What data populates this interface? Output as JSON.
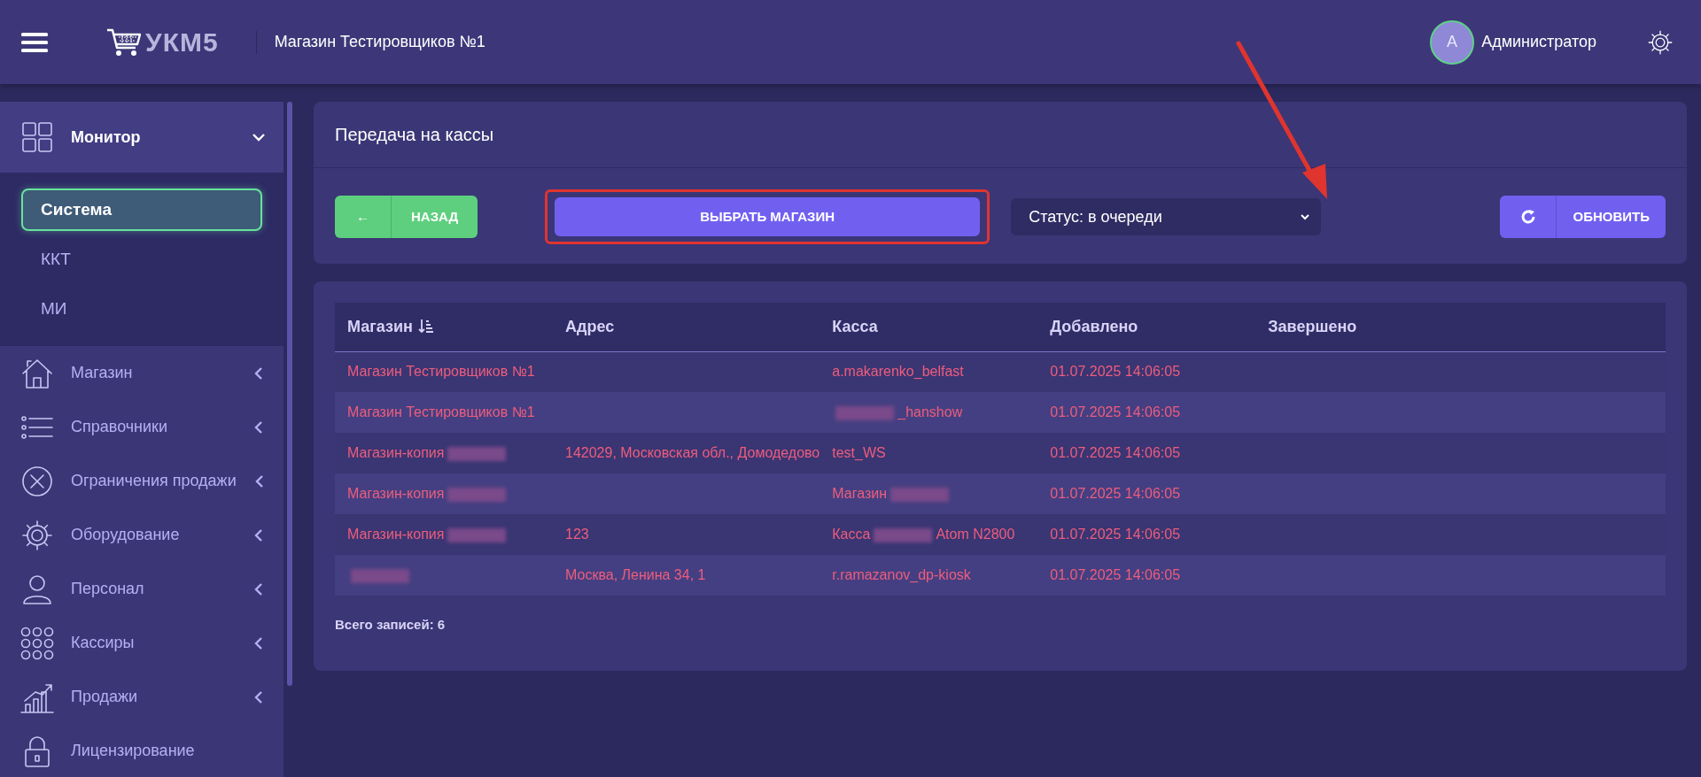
{
  "header": {
    "logo_text": "УКМ5",
    "store_title": "Магазин Тестировщиков №1",
    "user": {
      "avatar_letter": "А",
      "name": "Администратор"
    }
  },
  "sidebar": {
    "items": [
      {
        "label": "Монитор",
        "kind": "grid",
        "expanded": true,
        "children": [
          {
            "label": "Система",
            "selected": true
          },
          {
            "label": "ККТ",
            "selected": false
          },
          {
            "label": "МИ",
            "selected": false
          }
        ]
      },
      {
        "label": "Магазин",
        "kind": "house",
        "expanded": false
      },
      {
        "label": "Справочники",
        "kind": "list",
        "expanded": false
      },
      {
        "label": "Ограничения продажи",
        "kind": "xcircle",
        "expanded": false
      },
      {
        "label": "Оборудование",
        "kind": "gear",
        "expanded": false
      },
      {
        "label": "Персонал",
        "kind": "person",
        "expanded": false
      },
      {
        "label": "Кассиры",
        "kind": "dots",
        "expanded": false
      },
      {
        "label": "Продажи",
        "kind": "chart",
        "expanded": false
      },
      {
        "label": "Лицензирование",
        "kind": "lock"
      }
    ]
  },
  "panel": {
    "title": "Передача на кассы",
    "back_button": {
      "icon": "←",
      "label": "НАЗАД"
    },
    "select_store_button": {
      "label": "ВЫБРАТЬ МАГАЗИН",
      "highlighted": true
    },
    "status_select": {
      "value": "Статус: в очереди"
    },
    "refresh_button": {
      "label": "ОБНОВИТЬ"
    }
  },
  "annotation_arrow": true,
  "table": {
    "columns": [
      "Магазин",
      "Адрес",
      "Касса",
      "Добавлено",
      "Завершено"
    ],
    "rows": [
      [
        [
          {
            "kind": "text",
            "text": "Магазин Тестировщиков №1"
          }
        ],
        [],
        [
          {
            "kind": "text",
            "text": "a.makarenko_belfast"
          }
        ],
        [
          {
            "kind": "text",
            "text": "01.07.2025 14:06:05"
          }
        ],
        []
      ],
      [
        [
          {
            "kind": "text",
            "text": "Магазин Тестировщиков №1"
          }
        ],
        [],
        [
          {
            "kind": "redacted"
          },
          {
            "kind": "text",
            "text": "_hanshow"
          }
        ],
        [
          {
            "kind": "text",
            "text": "01.07.2025 14:06:05"
          }
        ],
        []
      ],
      [
        [
          {
            "kind": "text",
            "text": "Магазин-копия"
          },
          {
            "kind": "redacted"
          }
        ],
        [
          {
            "kind": "text",
            "text": "142029, Московская обл., Домодедово"
          }
        ],
        [
          {
            "kind": "text",
            "text": "test_WS"
          }
        ],
        [
          {
            "kind": "text",
            "text": "01.07.2025 14:06:05"
          }
        ],
        []
      ],
      [
        [
          {
            "kind": "text",
            "text": "Магазин-копия"
          },
          {
            "kind": "redacted"
          }
        ],
        [],
        [
          {
            "kind": "text",
            "text": "Магазин"
          },
          {
            "kind": "redacted"
          }
        ],
        [
          {
            "kind": "text",
            "text": "01.07.2025 14:06:05"
          }
        ],
        []
      ],
      [
        [
          {
            "kind": "text",
            "text": "Магазин-копия"
          },
          {
            "kind": "redacted"
          }
        ],
        [
          {
            "kind": "text",
            "text": "123"
          }
        ],
        [
          {
            "kind": "text",
            "text": "Касса"
          },
          {
            "kind": "redacted"
          },
          {
            "kind": "text",
            "text": "Atom N2800"
          }
        ],
        [
          {
            "kind": "text",
            "text": "01.07.2025 14:06:05"
          }
        ],
        []
      ],
      [
        [
          {
            "kind": "redacted"
          }
        ],
        [
          {
            "kind": "text",
            "text": "Москва, Ленина 34, 1"
          }
        ],
        [
          {
            "kind": "text",
            "text": "r.ramazanov_dp-kiosk"
          }
        ],
        [
          {
            "kind": "text",
            "text": "01.07.2025 14:06:05"
          }
        ],
        []
      ]
    ],
    "total": "Всего записей: 6"
  }
}
